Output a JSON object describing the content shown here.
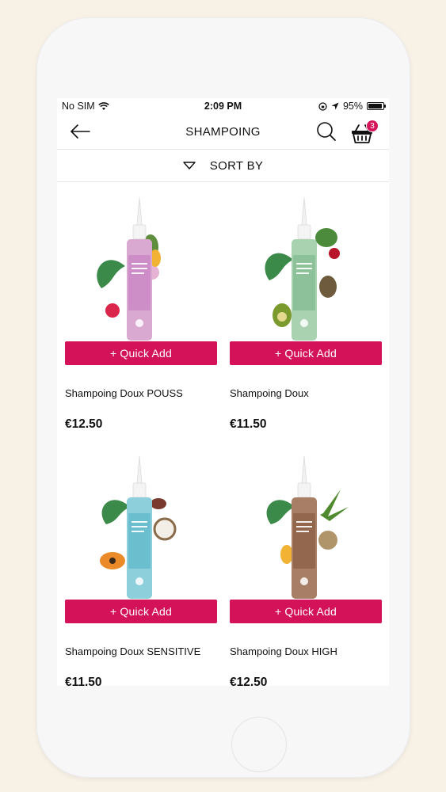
{
  "status_bar": {
    "carrier": "No SIM",
    "time": "2:09 PM",
    "battery": "95%"
  },
  "nav": {
    "title": "SHAMPOING",
    "cart_count": "3"
  },
  "sort": {
    "label": "SORT BY"
  },
  "products": [
    {
      "name": "Shampoing Doux POUSS",
      "price": "€12.50",
      "cta": "+ Quick Add",
      "bottle_color": "#d9a9d2",
      "label_color": "#c987c4"
    },
    {
      "name": "Shampoing Doux",
      "price": "€11.50",
      "cta": "+ Quick Add",
      "bottle_color": "#a9d2b1",
      "label_color": "#86bd94"
    },
    {
      "name": "Shampoing Doux SENSITIVE",
      "price": "€11.50",
      "cta": "+ Quick Add",
      "bottle_color": "#8ecfdc",
      "label_color": "#63b9cb"
    },
    {
      "name": "Shampoing Doux HIGH",
      "price": "€12.50",
      "cta": "+ Quick Add",
      "bottle_color": "#a87f66",
      "label_color": "#8c6248"
    }
  ],
  "colors": {
    "accent": "#d4125a",
    "background": "#f8f1e6"
  }
}
